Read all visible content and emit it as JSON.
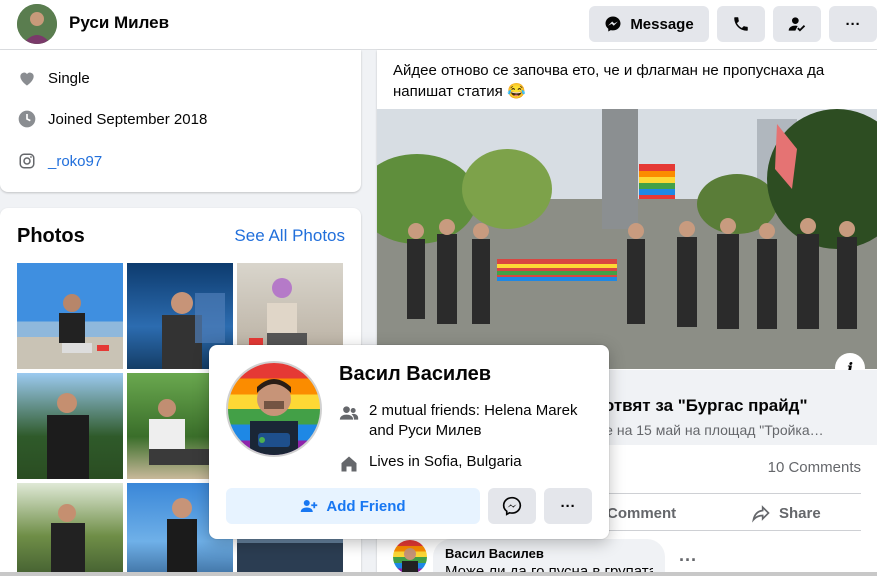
{
  "header": {
    "name": "Руси Милев",
    "message_label": "Message",
    "more_label": "···"
  },
  "intro": {
    "relationship": "Single",
    "joined": "Joined September 2018",
    "instagram": "_roko97"
  },
  "photos": {
    "title": "Photos",
    "see_all": "See All Photos"
  },
  "post": {
    "text": "Айдее отново се започва ето, че и флагман не пропуснаха да напишат статия 😂",
    "info": "i",
    "link_title": "готвят за \"Бургас прайд\"",
    "link_subtitle": "де на 15 май на площад \"Тройка…",
    "comments_count": "10 Comments",
    "comment_label": "Comment",
    "share_label": "Share",
    "comment": {
      "author": "Васил Василев",
      "text": "Може ли да го пусна в групата"
    },
    "comment_more": "···"
  },
  "hovercard": {
    "name": "Васил Василев",
    "mutual_prefix": "2 mutual friends: ",
    "mutual_friend_1": "Helena Marek",
    "mutual_and": " and ",
    "mutual_friend_2": "Руси Милев",
    "lives_prefix": "Lives in ",
    "lives_place": "Sofia, Bulgaria",
    "add_friend_label": "Add Friend",
    "more_label": "···"
  },
  "colors": {
    "accent": "#1877f2",
    "link": "#216fdb",
    "secondary_text": "#65676b"
  }
}
